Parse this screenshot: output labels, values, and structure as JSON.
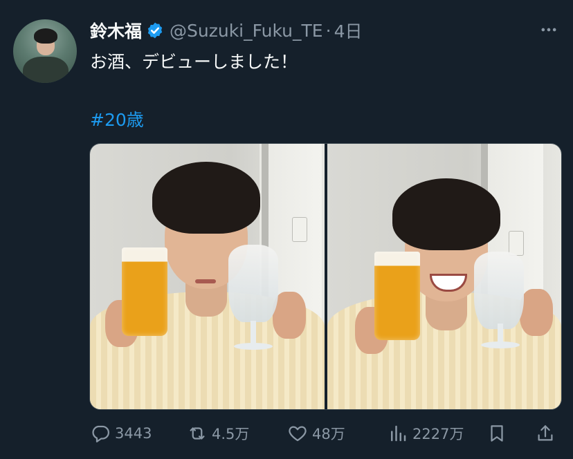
{
  "author": {
    "name": "鈴木福",
    "handle": "@Suzuki_Fuku_TE",
    "separator": "·",
    "time": "4日"
  },
  "tweet": {
    "text": "お酒、デビューしました！",
    "hashtag": "#20歳"
  },
  "actions": {
    "replies": "3443",
    "retweets": "4.5万",
    "likes": "48万",
    "views": "2227万"
  },
  "icons": {
    "verified": "verified-badge-icon",
    "more": "more-icon",
    "reply": "reply-icon",
    "retweet": "retweet-icon",
    "like": "heart-icon",
    "views": "views-icon",
    "bookmark": "bookmark-icon",
    "share": "share-icon"
  },
  "colors": {
    "background": "#15202b",
    "text": "#f7f9f9",
    "secondary": "#8b98a5",
    "accent": "#1d9bf0"
  }
}
